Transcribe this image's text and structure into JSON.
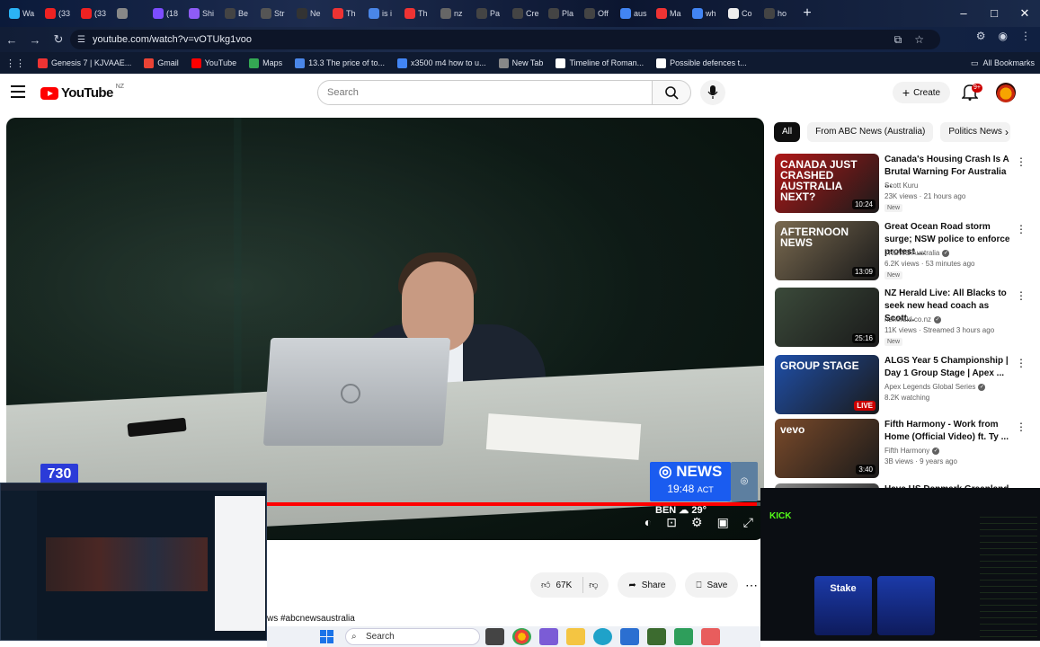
{
  "browser": {
    "tabs": [
      "Wa",
      "(33",
      "(33",
      "",
      "(18",
      "Shi",
      "Be",
      "Str",
      "Ne",
      "Th",
      "is i",
      "Th",
      "nz",
      "Pa",
      "Cre",
      "Pla",
      "Off",
      "aus",
      "Ma",
      "wh",
      "Co",
      "ho"
    ],
    "new_tab": "+",
    "url": "youtube.com/watch?v=vOTUkg1voo",
    "bookmarks": [
      "Genesis 7 | KJVAAE...",
      "Gmail",
      "YouTube",
      "Maps",
      "13.3 The price of to...",
      "x3500 m4 how to u...",
      "New Tab",
      "Timeline of Roman...",
      "Possible defences t..."
    ],
    "all_bookmarks": "All Bookmarks"
  },
  "youtube": {
    "logo_text": "YouTube",
    "country": "NZ",
    "search_placeholder": "Search",
    "create_label": "Create",
    "notifications": "9+"
  },
  "video": {
    "abc_logo_left": "730",
    "bug_brand": "NEWS",
    "bug_time": "19:48",
    "bug_tz": "ACT",
    "weather_city": "BEN",
    "weather_temp": "29°",
    "progress": 0.99,
    "likes": "67K",
    "share_label": "Share",
    "save_label": "Save",
    "hashtag": "ws #abcnewsaustralia"
  },
  "chips": [
    "All",
    "From ABC News (Australia)",
    "Politics News"
  ],
  "recommendations": [
    {
      "title": "Canada's Housing Crash Is A Brutal Warning For Australia ...",
      "channel": "Scott Kuru",
      "verified": false,
      "meta": "23K views · 21 hours ago",
      "badge": "New",
      "duration": "10:24",
      "thumb_text": "CANADA JUST CRASHED AUSTRALIA NEXT?",
      "thumb_color": "#b01818"
    },
    {
      "title": "Great Ocean Road storm surge; NSW police to enforce protest ...",
      "channel": "7NEWS Australia",
      "verified": true,
      "meta": "6.2K views · 53 minutes ago",
      "badge": "New",
      "duration": "13:09",
      "thumb_text": "AFTERNOON NEWS",
      "thumb_color": "#7a6a50"
    },
    {
      "title": "NZ Herald Live: All Blacks to seek new head coach as Scott...",
      "channel": "nzherald.co.nz",
      "verified": true,
      "meta": "11K views · Streamed 3 hours ago",
      "badge": "New",
      "duration": "25:16",
      "thumb_text": "",
      "thumb_color": "#3b4a3a"
    },
    {
      "title": "ALGS Year 5 Championship | Day 1 Group Stage | Apex ...",
      "channel": "Apex Legends Global Series",
      "verified": true,
      "meta": "8.2K watching",
      "badge": "",
      "duration": "LIVE",
      "thumb_text": "GROUP STAGE",
      "thumb_color": "#1f4fa8"
    },
    {
      "title": "Fifth Harmony - Work from Home (Official Video) ft. Ty ...",
      "channel": "Fifth Harmony",
      "verified": true,
      "meta": "3B views · 9 years ago",
      "badge": "",
      "duration": "3:40",
      "thumb_text": "vevo",
      "thumb_color": "#7a4a2a"
    },
    {
      "title": "Have US Denmark Greenland",
      "channel": "",
      "verified": false,
      "meta": "",
      "badge": "",
      "duration": "",
      "thumb_text": "",
      "thumb_color": "#888888"
    }
  ],
  "taskbar": {
    "search_label": "Search"
  },
  "overlay_right": {
    "kick_label": "KICK",
    "stake_label": "Stake"
  }
}
